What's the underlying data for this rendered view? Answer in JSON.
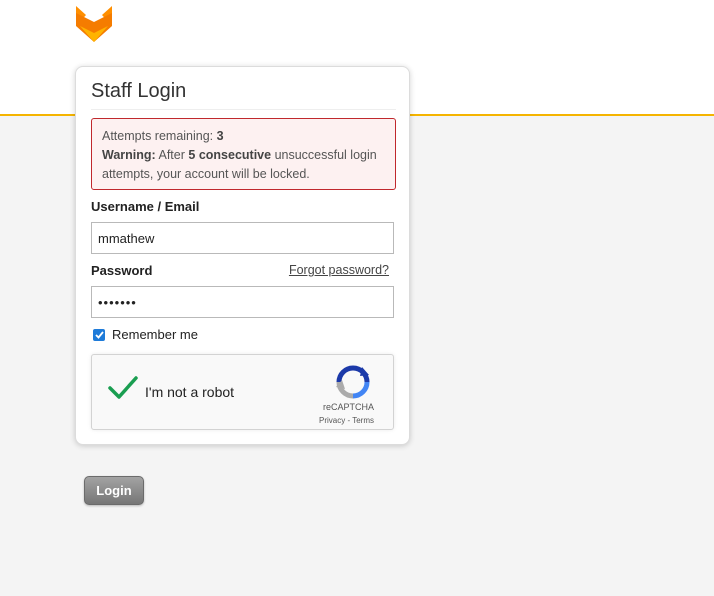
{
  "logo": {
    "icon": "fox-logo-icon",
    "colors": [
      "#f57c00",
      "#ffb300"
    ]
  },
  "login": {
    "title": "Staff Login",
    "alert": {
      "attempts_label": "Attempts remaining:",
      "attempts_value": "3",
      "warning_label": "Warning:",
      "warning_pre": "After",
      "warning_strong": "5 consecutive",
      "warning_post": "unsuccessful login attempts, your account will be locked."
    },
    "username": {
      "label": "Username / Email",
      "value": "mmathew"
    },
    "password": {
      "label": "Password",
      "value": "•••••••",
      "forgot_link": "Forgot password?"
    },
    "remember": {
      "label": "Remember me",
      "checked": true
    },
    "recaptcha": {
      "label": "I'm not a robot",
      "brand": "reCAPTCHA",
      "privacy": "Privacy",
      "separator": "-",
      "terms": "Terms"
    },
    "login_button": "Login"
  },
  "colors": {
    "accent": "#f5b400",
    "alert_border": "#c0282d",
    "check_green": "#1a9e51",
    "checkbox": "#1e7bd9"
  }
}
